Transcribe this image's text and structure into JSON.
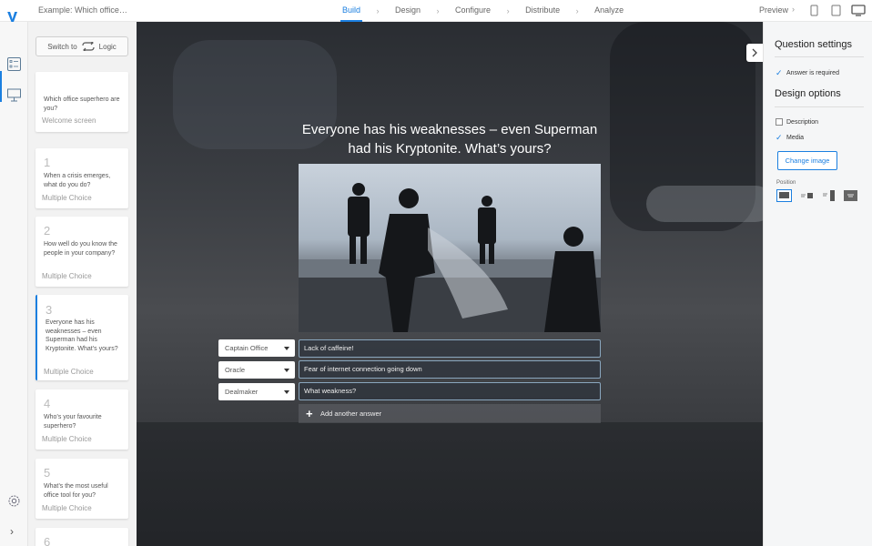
{
  "app": {
    "logo": "y",
    "doc_title": "Example: Which office…"
  },
  "nav": {
    "tabs": [
      "Build",
      "Design",
      "Configure",
      "Distribute",
      "Analyze"
    ],
    "active_tab": "Build",
    "preview_label": "Preview",
    "devices": [
      "phone-icon",
      "tablet-icon",
      "desktop-icon"
    ]
  },
  "sidebar": {
    "switch_label": "Switch to",
    "logic_label": "Logic",
    "questions": [
      {
        "number": "",
        "text": "Which office superhero are you?",
        "type": "Welcome screen"
      },
      {
        "number": "1",
        "text": "When a crisis emerges, what do you do?",
        "type": "Multiple Choice"
      },
      {
        "number": "2",
        "text": "How well do you know the people in your company?",
        "type": "Multiple Choice"
      },
      {
        "number": "3",
        "text": "Everyone has his weaknesses – even Superman had his Kryptonite. What’s yours?",
        "type": "Multiple Choice"
      },
      {
        "number": "4",
        "text": "Who’s your favourite superhero?",
        "type": "Multiple Choice"
      },
      {
        "number": "5",
        "text": "What’s the most useful office tool for you?",
        "type": "Multiple Choice"
      },
      {
        "number": "6",
        "text": "",
        "type": ""
      }
    ],
    "active_index": 3
  },
  "canvas": {
    "question": "Everyone has his weaknesses – even Superman had his Kryptonite. What’s yours?",
    "answers": [
      {
        "outcome": "Captain Office",
        "text": "Lack of caffeine!"
      },
      {
        "outcome": "Oracle",
        "text": "Fear of internet connection going down"
      },
      {
        "outcome": "Dealmaker",
        "text": "What weakness?"
      }
    ],
    "add_answer_label": "Add another answer"
  },
  "settings": {
    "question_settings_title": "Question settings",
    "answer_required_label": "Answer is required",
    "answer_required": true,
    "design_options_title": "Design options",
    "description_label": "Description",
    "description_checked": false,
    "media_label": "Media",
    "media_checked": true,
    "change_image_label": "Change image",
    "position_label": "Position",
    "position_options": [
      "full-width",
      "left-text",
      "right-image",
      "background"
    ],
    "accent_color": "#1b7fe0"
  }
}
